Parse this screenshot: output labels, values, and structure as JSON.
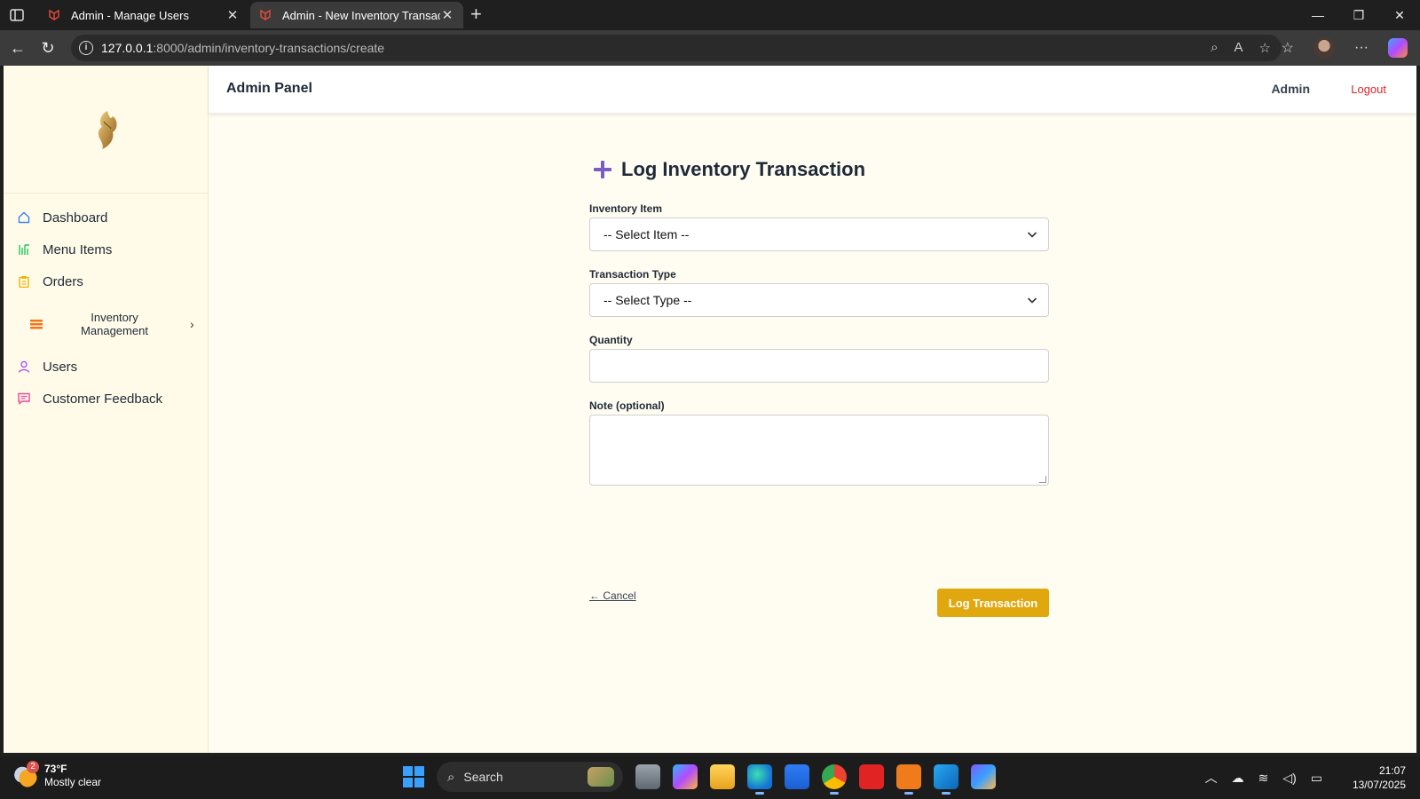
{
  "browser": {
    "tabs": [
      {
        "title": "Admin - Manage Users",
        "active": false
      },
      {
        "title": "Admin - New Inventory Transactio",
        "active": true
      }
    ],
    "url_host": "127.0.0.1",
    "url_path": ":8000/admin/inventory-transactions/create"
  },
  "topbar": {
    "brand": "Admin Panel",
    "user": "Admin",
    "logout": "Logout"
  },
  "sidebar": {
    "items": [
      {
        "label": "Dashboard",
        "icon": "home-icon",
        "color": "#3b82f6"
      },
      {
        "label": "Menu Items",
        "icon": "menu-bars-icon",
        "color": "#22c55e"
      },
      {
        "label": "Orders",
        "icon": "clipboard-icon",
        "color": "#eab308"
      },
      {
        "label": "Inventory Management",
        "icon": "layers-icon",
        "color": "#f97316"
      },
      {
        "label": "Users",
        "icon": "user-icon",
        "color": "#a855f7"
      },
      {
        "label": "Customer Feedback",
        "icon": "message-icon",
        "color": "#ec4899"
      }
    ]
  },
  "form": {
    "title": "Log Inventory Transaction",
    "item_label": "Inventory Item",
    "item_value": "-- Select Item --",
    "type_label": "Transaction Type",
    "type_value": "-- Select Type --",
    "quantity_label": "Quantity",
    "quantity_value": "",
    "note_label": "Note (optional)",
    "note_value": "",
    "cancel": "← Cancel",
    "submit": "Log Transaction",
    "accent": "#e0a70f"
  },
  "taskbar": {
    "weather_temp": "73°F",
    "weather_desc": "Mostly clear",
    "weather_badge": "2",
    "search": "Search",
    "time": "21:07",
    "date": "13/07/2025"
  }
}
